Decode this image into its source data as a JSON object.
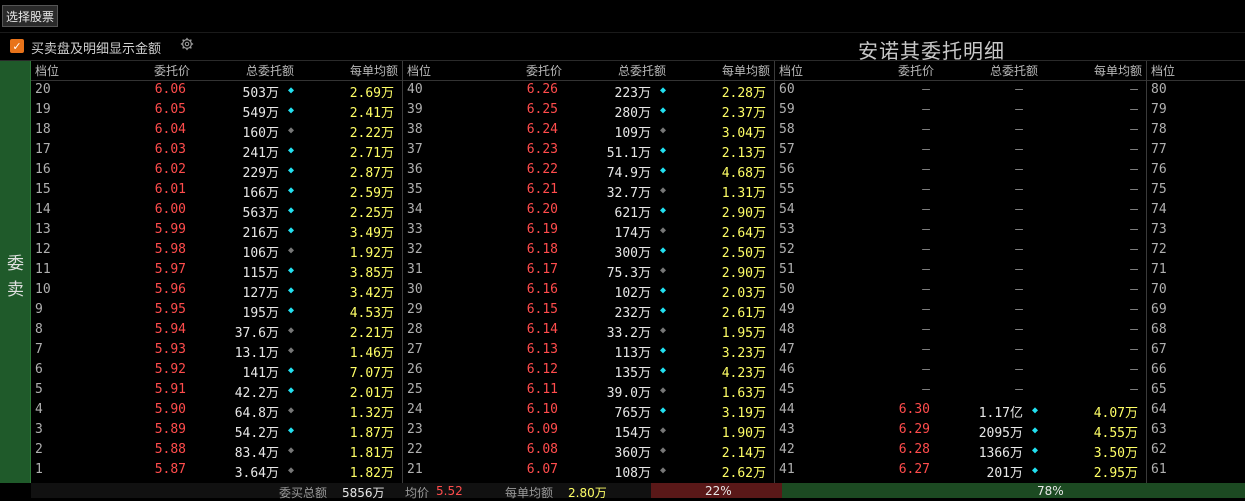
{
  "toolbar": {
    "select_stock_label": "选择股票"
  },
  "options": {
    "show_amount_label": "买卖盘及明细显示金额",
    "checked": true
  },
  "title": "安诺其委托明细",
  "sidebar": {
    "label_line1": "委",
    "label_line2": "卖"
  },
  "headers": {
    "level": "档位",
    "price": "委托价",
    "total": "总委托额",
    "avg": "每单均额"
  },
  "colors": {
    "price": "#ff4c4c",
    "avg": "#ffff66",
    "dot_active": "#22e0f0",
    "dot_inactive": "#777777"
  },
  "panels": [
    {
      "rows": [
        {
          "level": "20",
          "price": "6.06",
          "total": "503万",
          "dot": "cyan",
          "avg": "2.69万"
        },
        {
          "level": "19",
          "price": "6.05",
          "total": "549万",
          "dot": "cyan",
          "avg": "2.41万"
        },
        {
          "level": "18",
          "price": "6.04",
          "total": "160万",
          "dot": "gray",
          "avg": "2.22万"
        },
        {
          "level": "17",
          "price": "6.03",
          "total": "241万",
          "dot": "cyan",
          "avg": "2.71万"
        },
        {
          "level": "16",
          "price": "6.02",
          "total": "229万",
          "dot": "cyan",
          "avg": "2.87万"
        },
        {
          "level": "15",
          "price": "6.01",
          "total": "166万",
          "dot": "cyan",
          "avg": "2.59万"
        },
        {
          "level": "14",
          "price": "6.00",
          "total": "563万",
          "dot": "cyan",
          "avg": "2.25万"
        },
        {
          "level": "13",
          "price": "5.99",
          "total": "216万",
          "dot": "cyan",
          "avg": "3.49万"
        },
        {
          "level": "12",
          "price": "5.98",
          "total": "106万",
          "dot": "gray",
          "avg": "1.92万"
        },
        {
          "level": "11",
          "price": "5.97",
          "total": "115万",
          "dot": "cyan",
          "avg": "3.85万"
        },
        {
          "level": "10",
          "price": "5.96",
          "total": "127万",
          "dot": "cyan",
          "avg": "3.42万"
        },
        {
          "level": "9",
          "price": "5.95",
          "total": "195万",
          "dot": "cyan",
          "avg": "4.53万"
        },
        {
          "level": "8",
          "price": "5.94",
          "total": "37.6万",
          "dot": "gray",
          "avg": "2.21万"
        },
        {
          "level": "7",
          "price": "5.93",
          "total": "13.1万",
          "dot": "gray",
          "avg": "1.46万"
        },
        {
          "level": "6",
          "price": "5.92",
          "total": "141万",
          "dot": "cyan",
          "avg": "7.07万"
        },
        {
          "level": "5",
          "price": "5.91",
          "total": "42.2万",
          "dot": "cyan",
          "avg": "2.01万"
        },
        {
          "level": "4",
          "price": "5.90",
          "total": "64.8万",
          "dot": "gray",
          "avg": "1.32万"
        },
        {
          "level": "3",
          "price": "5.89",
          "total": "54.2万",
          "dot": "cyan",
          "avg": "1.87万"
        },
        {
          "level": "2",
          "price": "5.88",
          "total": "83.4万",
          "dot": "gray",
          "avg": "1.81万"
        },
        {
          "level": "1",
          "price": "5.87",
          "total": "3.64万",
          "dot": "gray",
          "avg": "1.82万"
        }
      ]
    },
    {
      "rows": [
        {
          "level": "40",
          "price": "6.26",
          "total": "223万",
          "dot": "cyan",
          "avg": "2.28万"
        },
        {
          "level": "39",
          "price": "6.25",
          "total": "280万",
          "dot": "cyan",
          "avg": "2.37万"
        },
        {
          "level": "38",
          "price": "6.24",
          "total": "109万",
          "dot": "gray",
          "avg": "3.04万"
        },
        {
          "level": "37",
          "price": "6.23",
          "total": "51.1万",
          "dot": "cyan",
          "avg": "2.13万"
        },
        {
          "level": "36",
          "price": "6.22",
          "total": "74.9万",
          "dot": "cyan",
          "avg": "4.68万"
        },
        {
          "level": "35",
          "price": "6.21",
          "total": "32.7万",
          "dot": "gray",
          "avg": "1.31万"
        },
        {
          "level": "34",
          "price": "6.20",
          "total": "621万",
          "dot": "cyan",
          "avg": "2.90万"
        },
        {
          "level": "33",
          "price": "6.19",
          "total": "174万",
          "dot": "gray",
          "avg": "2.64万"
        },
        {
          "level": "32",
          "price": "6.18",
          "total": "300万",
          "dot": "cyan",
          "avg": "2.50万"
        },
        {
          "level": "31",
          "price": "6.17",
          "total": "75.3万",
          "dot": "gray",
          "avg": "2.90万"
        },
        {
          "level": "30",
          "price": "6.16",
          "total": "102万",
          "dot": "cyan",
          "avg": "2.03万"
        },
        {
          "level": "29",
          "price": "6.15",
          "total": "232万",
          "dot": "cyan",
          "avg": "2.61万"
        },
        {
          "level": "28",
          "price": "6.14",
          "total": "33.2万",
          "dot": "gray",
          "avg": "1.95万"
        },
        {
          "level": "27",
          "price": "6.13",
          "total": "113万",
          "dot": "cyan",
          "avg": "3.23万"
        },
        {
          "level": "26",
          "price": "6.12",
          "total": "135万",
          "dot": "cyan",
          "avg": "4.23万"
        },
        {
          "level": "25",
          "price": "6.11",
          "total": "39.0万",
          "dot": "gray",
          "avg": "1.63万"
        },
        {
          "level": "24",
          "price": "6.10",
          "total": "765万",
          "dot": "cyan",
          "avg": "3.19万"
        },
        {
          "level": "23",
          "price": "6.09",
          "total": "154万",
          "dot": "gray",
          "avg": "1.90万"
        },
        {
          "level": "22",
          "price": "6.08",
          "total": "360万",
          "dot": "gray",
          "avg": "2.14万"
        },
        {
          "level": "21",
          "price": "6.07",
          "total": "108万",
          "dot": "gray",
          "avg": "2.62万"
        }
      ]
    },
    {
      "rows": [
        {
          "level": "60",
          "price": "—",
          "total": "—",
          "dot": "",
          "avg": "—"
        },
        {
          "level": "59",
          "price": "—",
          "total": "—",
          "dot": "",
          "avg": "—"
        },
        {
          "level": "58",
          "price": "—",
          "total": "—",
          "dot": "",
          "avg": "—"
        },
        {
          "level": "57",
          "price": "—",
          "total": "—",
          "dot": "",
          "avg": "—"
        },
        {
          "level": "56",
          "price": "—",
          "total": "—",
          "dot": "",
          "avg": "—"
        },
        {
          "level": "55",
          "price": "—",
          "total": "—",
          "dot": "",
          "avg": "—"
        },
        {
          "level": "54",
          "price": "—",
          "total": "—",
          "dot": "",
          "avg": "—"
        },
        {
          "level": "53",
          "price": "—",
          "total": "—",
          "dot": "",
          "avg": "—"
        },
        {
          "level": "52",
          "price": "—",
          "total": "—",
          "dot": "",
          "avg": "—"
        },
        {
          "level": "51",
          "price": "—",
          "total": "—",
          "dot": "",
          "avg": "—"
        },
        {
          "level": "50",
          "price": "—",
          "total": "—",
          "dot": "",
          "avg": "—"
        },
        {
          "level": "49",
          "price": "—",
          "total": "—",
          "dot": "",
          "avg": "—"
        },
        {
          "level": "48",
          "price": "—",
          "total": "—",
          "dot": "",
          "avg": "—"
        },
        {
          "level": "47",
          "price": "—",
          "total": "—",
          "dot": "",
          "avg": "—"
        },
        {
          "level": "46",
          "price": "—",
          "total": "—",
          "dot": "",
          "avg": "—"
        },
        {
          "level": "45",
          "price": "—",
          "total": "—",
          "dot": "",
          "avg": "—"
        },
        {
          "level": "44",
          "price": "6.30",
          "total": "1.17亿",
          "dot": "cyan",
          "avg": "4.07万"
        },
        {
          "level": "43",
          "price": "6.29",
          "total": "2095万",
          "dot": "cyan",
          "avg": "4.55万"
        },
        {
          "level": "42",
          "price": "6.28",
          "total": "1366万",
          "dot": "cyan",
          "avg": "3.50万"
        },
        {
          "level": "41",
          "price": "6.27",
          "total": "201万",
          "dot": "cyan",
          "avg": "2.95万"
        }
      ]
    },
    {
      "rows": [
        {
          "level": "80"
        },
        {
          "level": "79"
        },
        {
          "level": "78"
        },
        {
          "level": "77"
        },
        {
          "level": "76"
        },
        {
          "level": "75"
        },
        {
          "level": "74"
        },
        {
          "level": "73"
        },
        {
          "level": "72"
        },
        {
          "level": "71"
        },
        {
          "level": "70"
        },
        {
          "level": "69"
        },
        {
          "level": "68"
        },
        {
          "level": "67"
        },
        {
          "level": "66"
        },
        {
          "level": "65"
        },
        {
          "level": "64"
        },
        {
          "level": "63"
        },
        {
          "level": "62"
        },
        {
          "level": "61"
        }
      ]
    }
  ],
  "footer": {
    "total_label": "委买总额",
    "total_value": "5856万",
    "avgprice_label": "均价",
    "avgprice_value": "5.52",
    "avg_label": "每单均额",
    "avg_value": "2.80万",
    "sell_pct": "22%",
    "buy_pct": "78%",
    "sell_fraction": 0.22,
    "buy_fraction": 0.78
  }
}
